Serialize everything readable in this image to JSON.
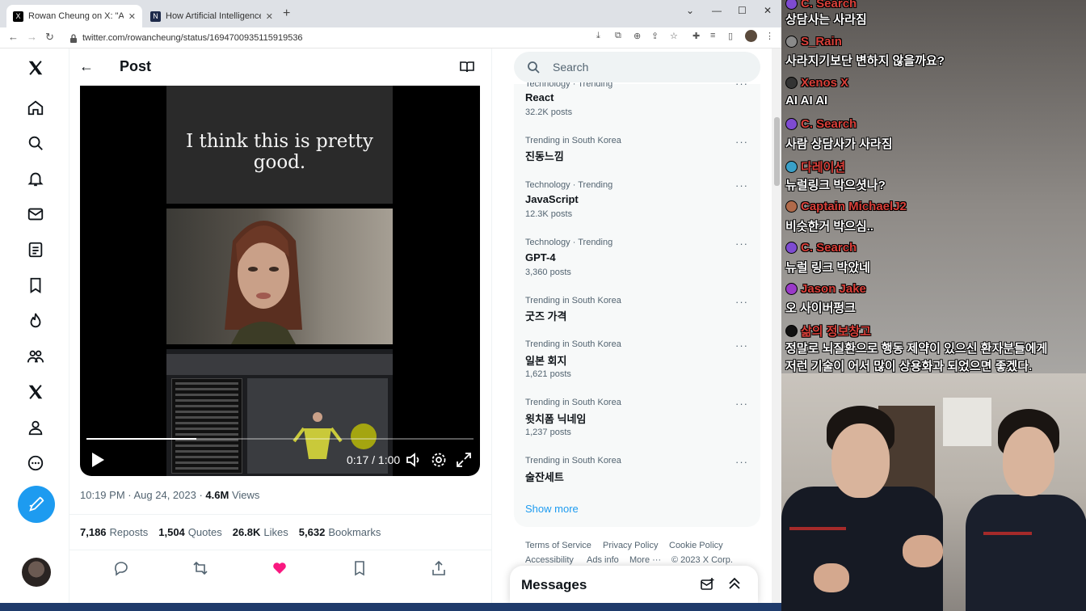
{
  "browser": {
    "tabs": [
      {
        "title": "Rowan Cheung on X: \"AI contin",
        "active": true
      },
      {
        "title": "How Artificial Intelligence Gave",
        "active": false
      }
    ],
    "url": "twitter.com/rowancheung/status/1694700935115919536"
  },
  "nav": {
    "icons": [
      "x-logo-icon",
      "home-icon",
      "explore-icon",
      "notifications-icon",
      "messages-icon",
      "lists-icon",
      "bookmarks-icon",
      "trending-icon",
      "communities-icon",
      "premium-icon",
      "profile-icon",
      "more-icon"
    ]
  },
  "post": {
    "header_title": "Post",
    "video": {
      "caption": "I think this is pretty good.",
      "time": "0:17 / 1:00",
      "progress_fraction": 0.283
    },
    "time": "10:19 PM",
    "date": "Aug 24, 2023",
    "views_count": "4.6M",
    "views_label": "Views",
    "stats": [
      {
        "count": "7,186",
        "label": "Reposts"
      },
      {
        "count": "1,504",
        "label": "Quotes"
      },
      {
        "count": "26.8K",
        "label": "Likes"
      },
      {
        "count": "5,632",
        "label": "Bookmarks"
      }
    ]
  },
  "sidebar": {
    "search_placeholder": "Search",
    "trends": [
      {
        "category": "Technology · Trending",
        "name": "React",
        "count": "32.2K posts"
      },
      {
        "category": "Trending in South Korea",
        "name": "진동느낌",
        "count": ""
      },
      {
        "category": "Technology · Trending",
        "name": "JavaScript",
        "count": "12.3K posts"
      },
      {
        "category": "Technology · Trending",
        "name": "GPT-4",
        "count": "3,360 posts"
      },
      {
        "category": "Trending in South Korea",
        "name": "굿즈 가격",
        "count": ""
      },
      {
        "category": "Trending in South Korea",
        "name": "일본 회지",
        "count": "1,621 posts"
      },
      {
        "category": "Trending in South Korea",
        "name": "윗치폼 닉네임",
        "count": "1,237 posts"
      },
      {
        "category": "Trending in South Korea",
        "name": "술잔세트",
        "count": ""
      }
    ],
    "show_more": "Show more",
    "footer": {
      "terms": "Terms of Service",
      "privacy": "Privacy Policy",
      "cookie": "Cookie Policy",
      "accessibility": "Accessibility",
      "ads": "Ads info",
      "more": "More ···",
      "copyright": "© 2023 X Corp."
    },
    "messages_title": "Messages"
  },
  "chat": [
    {
      "name": "C. Search",
      "name_color": "#d9403a",
      "badge_color": "#7e4bd1",
      "message": "상담사는 사라짐"
    },
    {
      "name": "S_Rain",
      "name_color": "#d9403a",
      "badge_color": "#8a8a8a",
      "message": "사라지기보단 변하지 않을까요?"
    },
    {
      "name": "Xenos X",
      "name_color": "#d9403a",
      "badge_color": "#333333",
      "message": "AI AI AI"
    },
    {
      "name": "C. Search",
      "name_color": "#d9403a",
      "badge_color": "#7e4bd1",
      "message": "사람 상담사가 사라짐"
    },
    {
      "name": "다레이션",
      "name_color": "#d9403a",
      "badge_color": "#3aa0c8",
      "message": "뉴럴링크 박으셧나?"
    },
    {
      "name": "Captain MichaelJ2",
      "name_color": "#d9403a",
      "badge_color": "#b06a4a",
      "message": "비슷한거 박으심.."
    },
    {
      "name": "C. Search",
      "name_color": "#d9403a",
      "badge_color": "#7e4bd1",
      "message": "뉴럴 링크 박았네"
    },
    {
      "name": "Jason Jake",
      "name_color": "#d9403a",
      "badge_color": "#9a3ac8",
      "message": "오 사이버펑크"
    },
    {
      "name": "삶의 정보창고",
      "name_color": "#d9403a",
      "badge_color": "#111111",
      "message": "정말로 뇌질환으로 행동 제약이 있으신 환자분들에게",
      "message2": "저런 기술이 어서 많이 상용화과 되었으면 좋겠다."
    }
  ]
}
